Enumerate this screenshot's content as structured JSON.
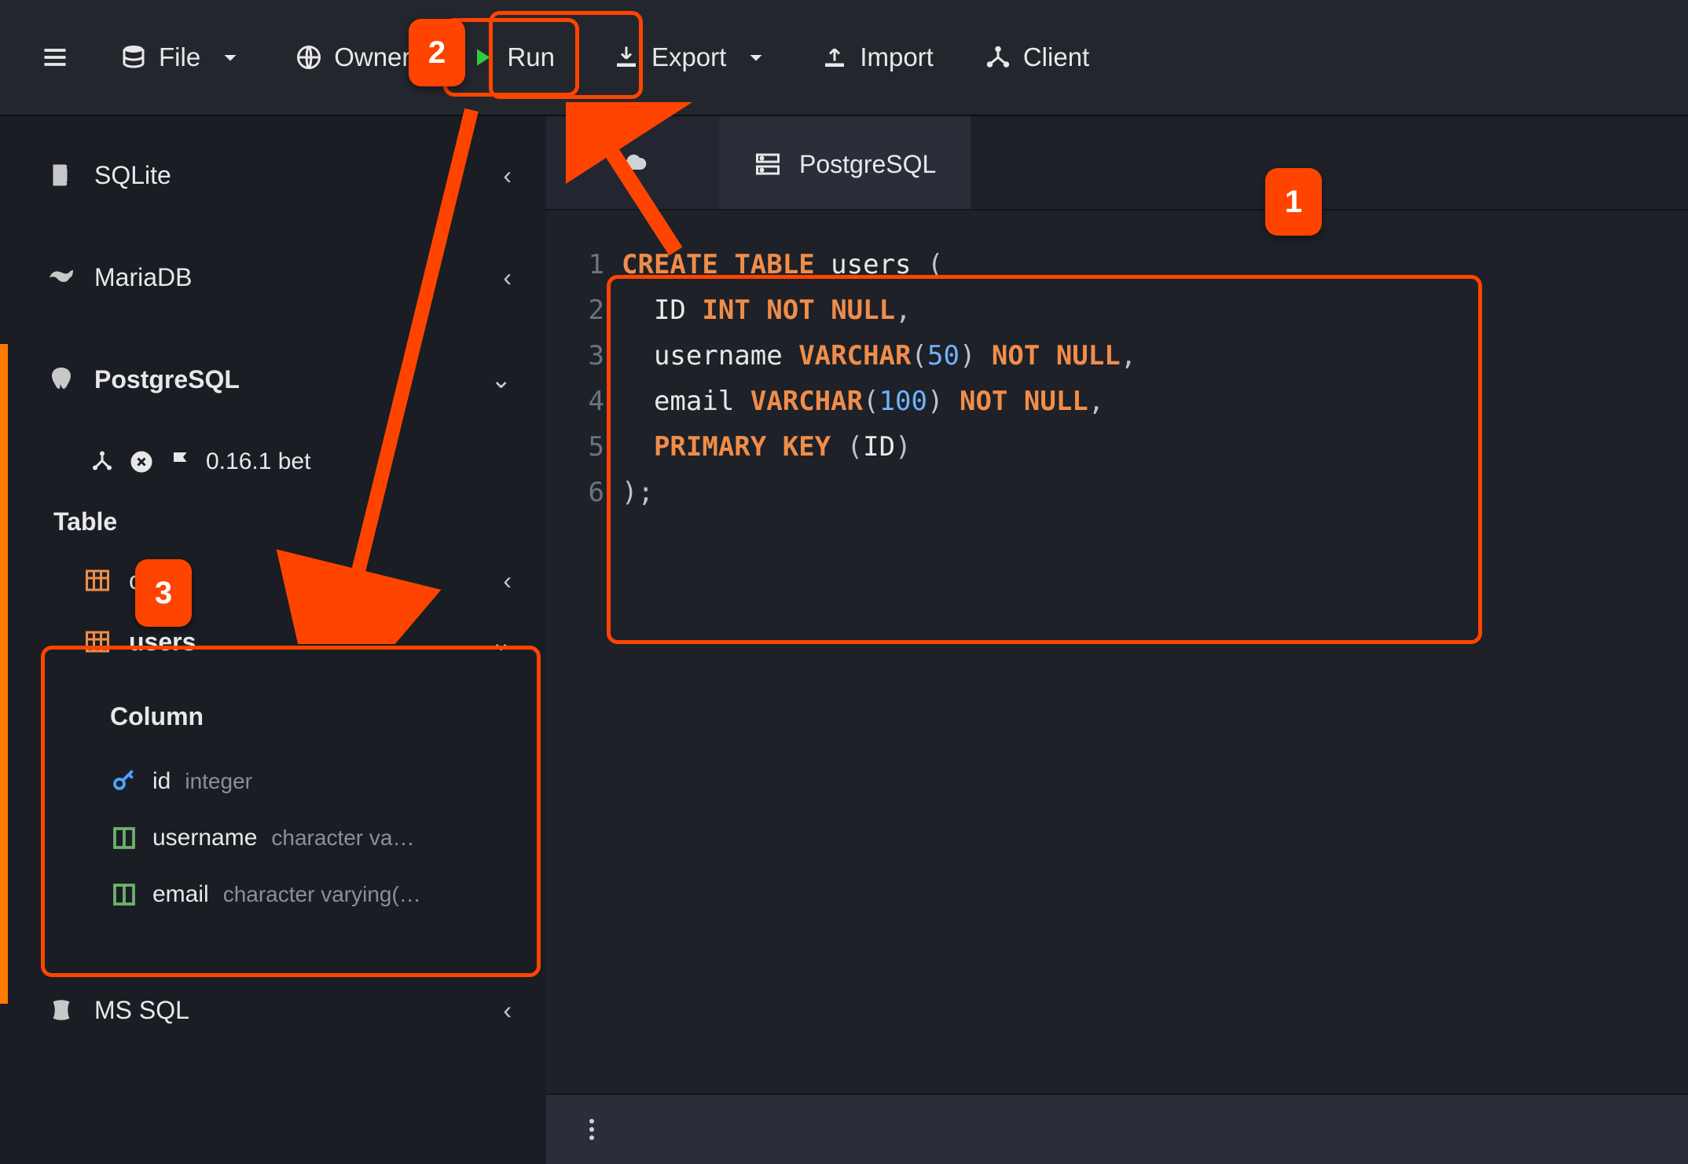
{
  "toolbar": {
    "file_label": "File",
    "owner_label": "Owner",
    "run_label": "Run",
    "export_label": "Export",
    "import_label": "Import",
    "client_label": "Client"
  },
  "sidebar": {
    "databases": [
      {
        "name": "SQLite",
        "bold": false,
        "expanded": false
      },
      {
        "name": "MariaDB",
        "bold": false,
        "expanded": false
      },
      {
        "name": "PostgreSQL",
        "bold": true,
        "expanded": true
      },
      {
        "name": "MS SQL",
        "bold": false,
        "expanded": false
      }
    ],
    "connection": {
      "version": "0.16.1 bet"
    },
    "table_section_label": "Table",
    "tables": [
      {
        "name": "o",
        "visible_name": "o",
        "expanded": false
      },
      {
        "name": "users",
        "visible_name": "users",
        "expanded": true
      }
    ],
    "column_heading": "Column",
    "columns": [
      {
        "name": "id",
        "type": "integer",
        "pk": true
      },
      {
        "name": "username",
        "type": "character va…",
        "pk": false
      },
      {
        "name": "email",
        "type": "character varying(…",
        "pk": false
      }
    ]
  },
  "tabs": {
    "active_label": "PostgreSQL"
  },
  "editor": {
    "lines": [
      {
        "n": 1,
        "tokens": [
          [
            "kw",
            "CREATE"
          ],
          [
            "sp",
            " "
          ],
          [
            "kw",
            "TABLE"
          ],
          [
            "sp",
            " "
          ],
          [
            "id",
            "users"
          ],
          [
            "sp",
            " "
          ],
          [
            "pun",
            "("
          ]
        ]
      },
      {
        "n": 2,
        "tokens": [
          [
            "sp",
            "  "
          ],
          [
            "id",
            "ID"
          ],
          [
            "sp",
            " "
          ],
          [
            "typ",
            "INT"
          ],
          [
            "sp",
            " "
          ],
          [
            "kw",
            "NOT"
          ],
          [
            "sp",
            " "
          ],
          [
            "kw",
            "NULL"
          ],
          [
            "pun",
            ","
          ]
        ]
      },
      {
        "n": 3,
        "tokens": [
          [
            "sp",
            "  "
          ],
          [
            "id",
            "username"
          ],
          [
            "sp",
            " "
          ],
          [
            "typ",
            "VARCHAR"
          ],
          [
            "pun",
            "("
          ],
          [
            "num",
            "50"
          ],
          [
            "pun",
            ")"
          ],
          [
            "sp",
            " "
          ],
          [
            "kw",
            "NOT"
          ],
          [
            "sp",
            " "
          ],
          [
            "kw",
            "NULL"
          ],
          [
            "pun",
            ","
          ]
        ]
      },
      {
        "n": 4,
        "tokens": [
          [
            "sp",
            "  "
          ],
          [
            "id",
            "email"
          ],
          [
            "sp",
            " "
          ],
          [
            "typ",
            "VARCHAR"
          ],
          [
            "pun",
            "("
          ],
          [
            "num",
            "100"
          ],
          [
            "pun",
            ")"
          ],
          [
            "sp",
            " "
          ],
          [
            "kw",
            "NOT"
          ],
          [
            "sp",
            " "
          ],
          [
            "kw",
            "NULL"
          ],
          [
            "pun",
            ","
          ]
        ]
      },
      {
        "n": 5,
        "tokens": [
          [
            "sp",
            "  "
          ],
          [
            "kw",
            "PRIMARY"
          ],
          [
            "sp",
            " "
          ],
          [
            "kw",
            "KEY"
          ],
          [
            "sp",
            " "
          ],
          [
            "pun",
            "("
          ],
          [
            "id",
            "ID"
          ],
          [
            "pun",
            ")"
          ]
        ]
      },
      {
        "n": 6,
        "tokens": [
          [
            "pun",
            ")"
          ],
          [
            "pun",
            ";"
          ]
        ]
      }
    ]
  },
  "annotations": {
    "badges": {
      "1": "1",
      "2": "2",
      "3": "3"
    }
  }
}
